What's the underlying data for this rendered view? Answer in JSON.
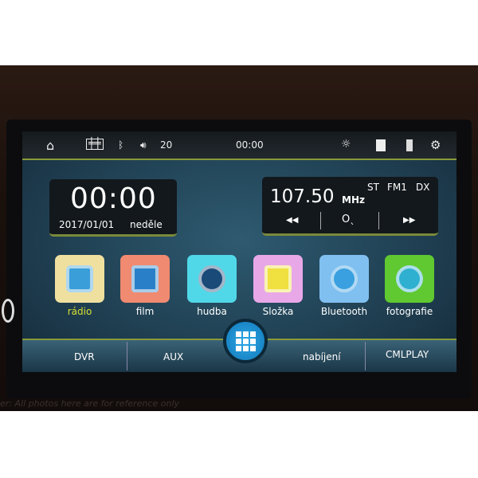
{
  "status": {
    "volume": "20",
    "time": "00:00",
    "icons": [
      "home-icon",
      "equalizer-icon",
      "bluetooth-icon",
      "volume-icon",
      "brightness-icon",
      "sd-card-icon",
      "usb-icon",
      "gear-icon"
    ]
  },
  "clock": {
    "time": "00:00",
    "date": "2017/01/01",
    "weekday": "neděle"
  },
  "radio": {
    "frequency": "107.50",
    "unit": "MHz",
    "stereo": "ST",
    "band": "FM1",
    "dx": "DX",
    "prev": "◀◀",
    "search": "Oˎ",
    "next": "▶▶"
  },
  "apps": [
    {
      "label": "rádio",
      "color": "#f0e0a0",
      "label_color": "#d8e030"
    },
    {
      "label": "film",
      "color": "#f08a70",
      "label_color": "#ffffff"
    },
    {
      "label": "hudba",
      "color": "#50d8e8",
      "label_color": "#ffffff"
    },
    {
      "label": "Složka",
      "color": "#e8a8e8",
      "label_color": "#ffffff"
    },
    {
      "label": "Bluetooth",
      "color": "#80c0f0",
      "label_color": "#ffffff"
    },
    {
      "label": "fotografie",
      "color": "#60c830",
      "label_color": "#ffffff"
    }
  ],
  "bottom": {
    "dvr": "DVR",
    "aux": "AUX",
    "charging": "nabíjení",
    "cmlplay": "CMLPLAY"
  },
  "watermark": "er: All photos here are for reference only"
}
